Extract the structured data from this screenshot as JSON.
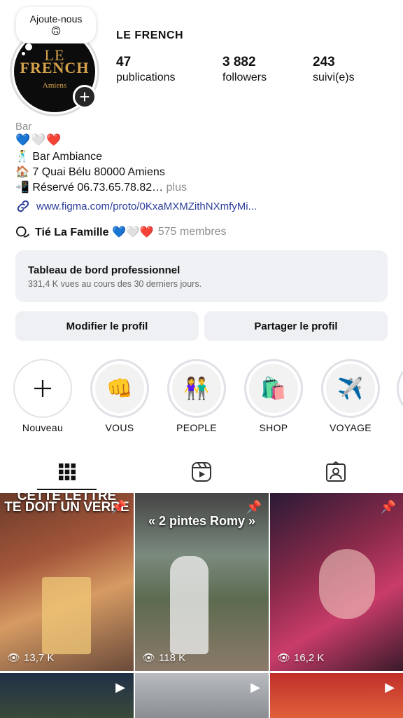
{
  "profile": {
    "note_text": "Ajoute-nous",
    "note_emoji": "🙃",
    "username": "LE FRENCH",
    "logo_top": "LE",
    "logo_main": "FRENCH",
    "logo_sub": "Amiens",
    "stats": [
      {
        "value": "47",
        "label": "publications"
      },
      {
        "value": "3 882",
        "label": "followers"
      },
      {
        "value": "243",
        "label": "suivi(e)s"
      }
    ],
    "category": "Bar",
    "hearts": "💙🤍❤️",
    "bio_lines": [
      "🕺 Bar Ambiance",
      "🏠 7 Quai Bélu 80000 Amiens",
      "📲 Réservé 06.73.65.78.82…"
    ],
    "more_label": "plus",
    "link": "www.figma.com/proto/0KxaMXMZithNXmfyMi...",
    "channel_name": "Tié La Famille 💙🤍❤️",
    "channel_members": "575 membres"
  },
  "dashboard": {
    "title": "Tableau de bord professionnel",
    "subtitle": "331,4 K vues au cours des 30 derniers jours."
  },
  "buttons": {
    "edit": "Modifier le profil",
    "share": "Partager le profil"
  },
  "highlights": [
    {
      "label": "Nouveau",
      "icon": "plus-icon"
    },
    {
      "label": "VOUS",
      "emoji": "👊"
    },
    {
      "label": "PEOPLE",
      "emoji": "👫"
    },
    {
      "label": "SHOP",
      "emoji": "🛍️"
    },
    {
      "label": "VOYAGE",
      "emoji": "✈️"
    }
  ],
  "tabs": [
    "grid-icon",
    "reels-icon",
    "tagged-icon"
  ],
  "posts": [
    {
      "caption_line1": "CETTE LETTRE",
      "caption_line2": "TE DOIT UN VERRE",
      "views": "13,7 K"
    },
    {
      "caption_line1": "« 2 pintes Romy »",
      "views": "118 K"
    },
    {
      "views": "16,2 K"
    }
  ]
}
